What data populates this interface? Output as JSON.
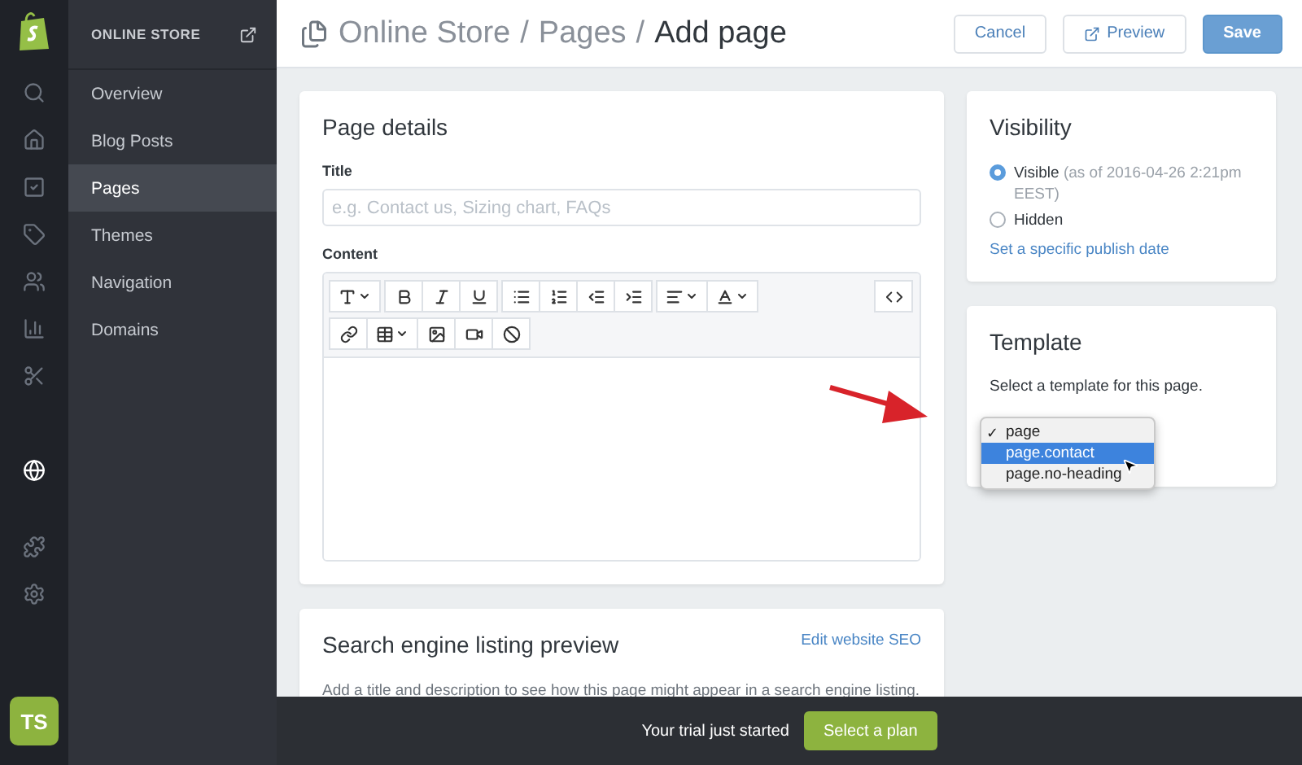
{
  "rail": [
    {
      "selected": false
    },
    {
      "selected": false
    },
    {
      "selected": false
    },
    {
      "selected": false
    },
    {
      "selected": false
    },
    {
      "selected": false
    },
    {
      "selected": false
    },
    {
      "selected": true
    },
    {
      "selected": false
    },
    {
      "selected": false
    }
  ],
  "avatar": "TS",
  "sidebar": {
    "heading": "ONLINE STORE",
    "items": [
      {
        "label": "Overview",
        "selected": false
      },
      {
        "label": "Blog Posts",
        "selected": false
      },
      {
        "label": "Pages",
        "selected": true
      },
      {
        "label": "Themes",
        "selected": false
      },
      {
        "label": "Navigation",
        "selected": false
      },
      {
        "label": "Domains",
        "selected": false
      }
    ]
  },
  "header": {
    "breadcrumb": [
      "Online Store",
      "/",
      "Pages",
      "/"
    ],
    "title": "Add page",
    "buttons": [
      {
        "label": "Cancel",
        "kind": "secondary"
      },
      {
        "label": "Preview",
        "kind": "preview"
      },
      {
        "label": "Save",
        "kind": "primary"
      }
    ]
  },
  "page_details": {
    "title": "Page details",
    "title_label": "Title",
    "title_placeholder": "e.g. Contact us, Sizing chart, FAQs",
    "content_label": "Content"
  },
  "visibility": {
    "title": "Visibility",
    "options": [
      {
        "label": "Visible",
        "note": "(as of 2016-04-26 2:21pm EEST)",
        "selected": true
      },
      {
        "label": "Hidden",
        "selected": false
      }
    ],
    "link": "Set a specific publish date"
  },
  "template": {
    "title": "Template",
    "hint": "Select a template for this page.",
    "options": [
      {
        "label": "page",
        "checked": true,
        "hovered": false
      },
      {
        "label": "page.contact",
        "checked": false,
        "hovered": true
      },
      {
        "label": "page.no-heading",
        "checked": false,
        "hovered": false
      }
    ],
    "check_mark": "✓"
  },
  "seo": {
    "title": "Search engine listing preview",
    "link": "Edit website SEO",
    "description": "Add a title and description to see how this page might appear in a search engine listing."
  },
  "trial": {
    "text": "Your trial just started",
    "button": "Select a plan"
  }
}
